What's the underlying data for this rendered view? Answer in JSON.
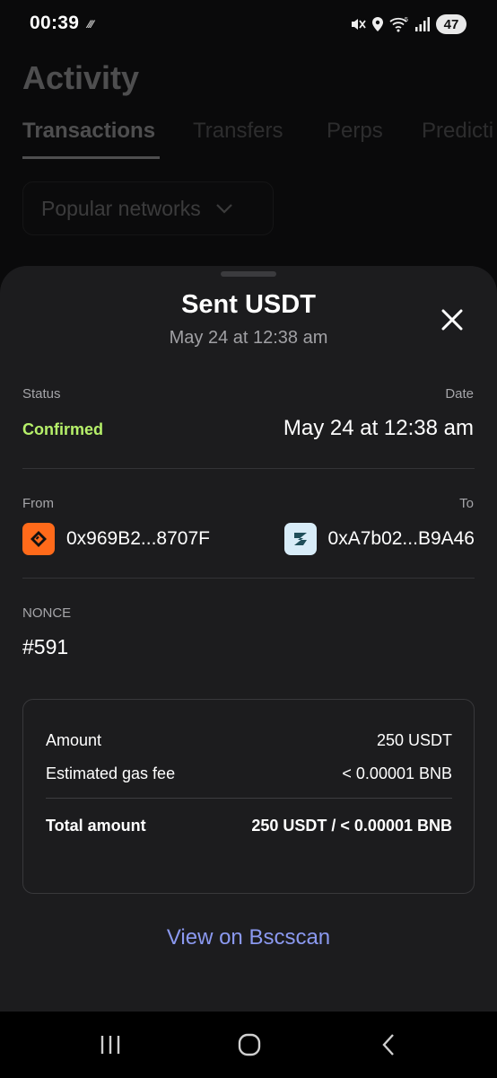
{
  "status_bar": {
    "time": "00:39",
    "notification_icons": "⁄⁄⁄",
    "wifi_badge": "5",
    "battery": "47"
  },
  "background": {
    "title": "Activity",
    "tabs": [
      "Transactions",
      "Transfers",
      "Perps",
      "Predicti"
    ],
    "active_tab": "Transactions",
    "network_filter": "Popular networks"
  },
  "sheet": {
    "title": "Sent USDT",
    "subtitle": "May 24 at 12:38 am",
    "status_label": "Status",
    "status_value": "Confirmed",
    "date_label": "Date",
    "date_value": "May 24 at 12:38 am",
    "from_label": "From",
    "from_address": "0x969B2...8707F",
    "to_label": "To",
    "to_address": "0xA7b02...B9A46",
    "nonce_label": "NONCE",
    "nonce_value": "#591",
    "summary": {
      "amount_label": "Amount",
      "amount_value": "250 USDT",
      "gas_label": "Estimated gas fee",
      "gas_value": "< 0.00001 BNB",
      "total_label": "Total amount",
      "total_value": "250 USDT / < 0.00001 BNB"
    },
    "link": "View on Bscscan"
  },
  "colors": {
    "accent_green": "#b6f06a",
    "link_blue": "#8b99f0",
    "sheet_bg": "#1c1c1e",
    "from_avatar": "#ff6a1a",
    "to_avatar": "#d8ecf8"
  },
  "icons": [
    "mute-icon",
    "location-icon",
    "wifi-icon",
    "signal-icon",
    "battery-icon",
    "chevron-down-icon",
    "close-icon",
    "recents-icon",
    "home-icon",
    "back-icon"
  ]
}
